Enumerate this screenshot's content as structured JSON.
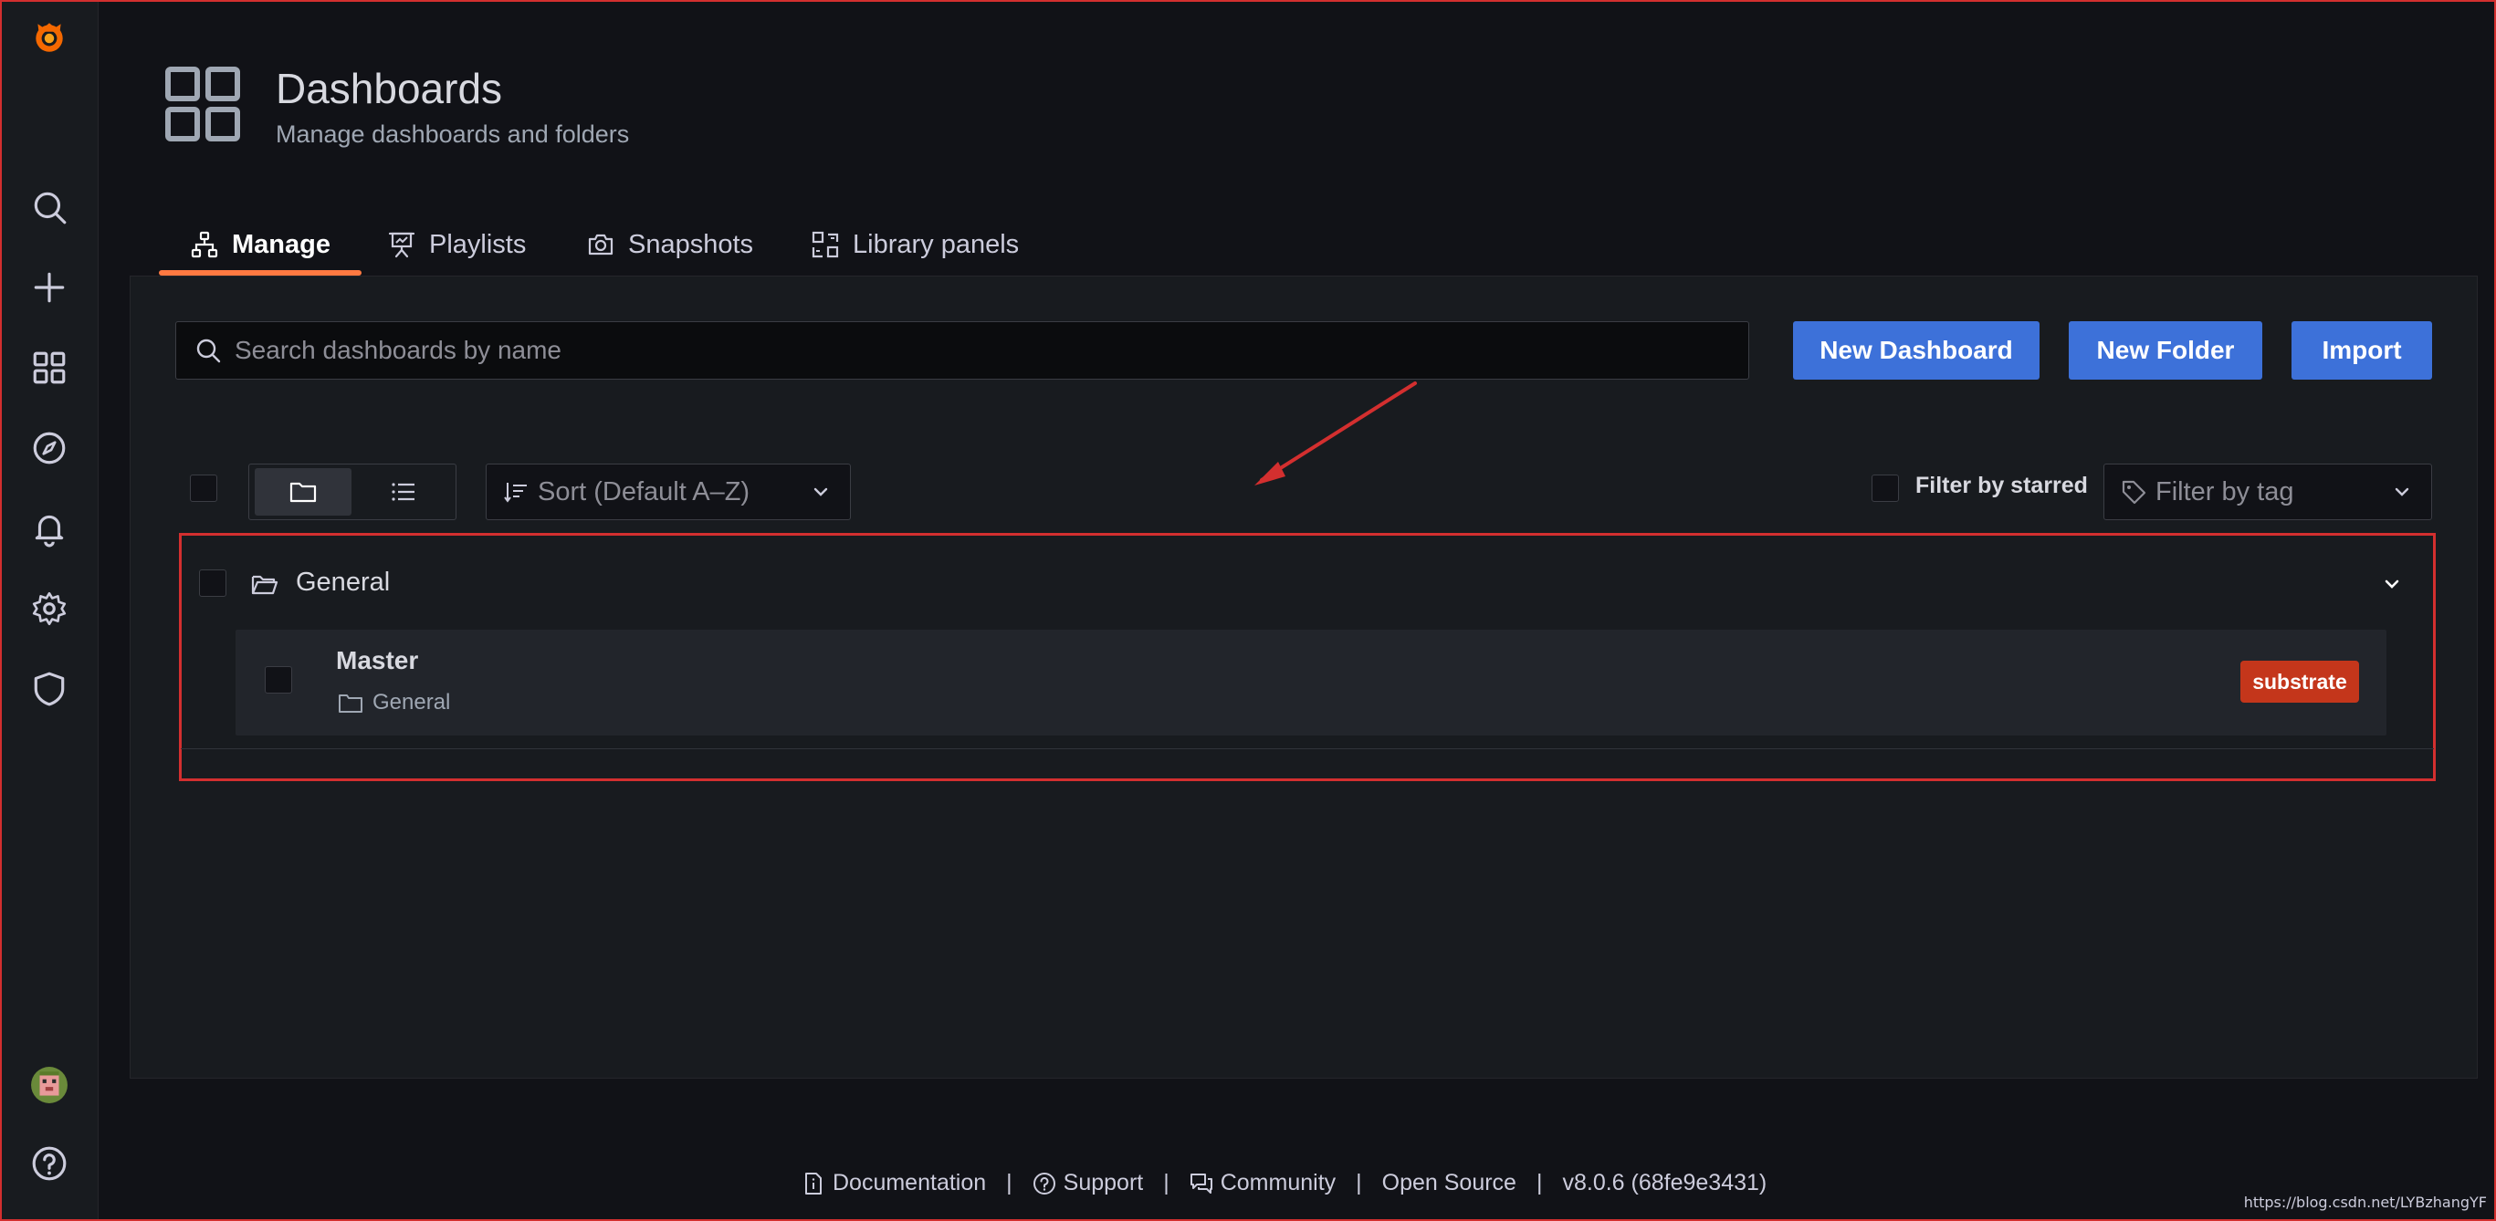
{
  "sidebar": {
    "items": [
      {
        "name": "grafana-logo"
      },
      {
        "name": "search-icon"
      },
      {
        "name": "create-icon"
      },
      {
        "name": "dashboards-icon"
      },
      {
        "name": "explore-icon"
      },
      {
        "name": "alerting-icon"
      },
      {
        "name": "configuration-icon"
      },
      {
        "name": "server-admin-icon"
      }
    ]
  },
  "header": {
    "title": "Dashboards",
    "subtitle": "Manage dashboards and folders"
  },
  "tabs": [
    {
      "label": "Manage",
      "icon": "sitemap-icon",
      "active": true
    },
    {
      "label": "Playlists",
      "icon": "presentation-icon",
      "active": false
    },
    {
      "label": "Snapshots",
      "icon": "camera-icon",
      "active": false
    },
    {
      "label": "Library panels",
      "icon": "library-panel-icon",
      "active": false
    }
  ],
  "toolbar": {
    "search_placeholder": "Search dashboards by name",
    "new_dashboard": "New Dashboard",
    "new_folder": "New Folder",
    "import": "Import"
  },
  "filters": {
    "sort_placeholder": "Sort (Default A–Z)",
    "starred_label": "Filter by starred",
    "tag_placeholder": "Filter by tag"
  },
  "folders": [
    {
      "name": "General",
      "dashboards": [
        {
          "title": "Master",
          "folder": "General",
          "tags": [
            "substrate"
          ]
        }
      ]
    }
  ],
  "footer": {
    "documentation": "Documentation",
    "support": "Support",
    "community": "Community",
    "open_source": "Open Source",
    "version": "v8.0.6 (68fe9e3431)"
  },
  "watermark": "https://blog.csdn.net/LYBzhangYF",
  "colors": {
    "primary": "#3d71d9",
    "tag": "#c4361b",
    "tab_underline": "#ff7941",
    "annotation": "#d32f2f"
  }
}
